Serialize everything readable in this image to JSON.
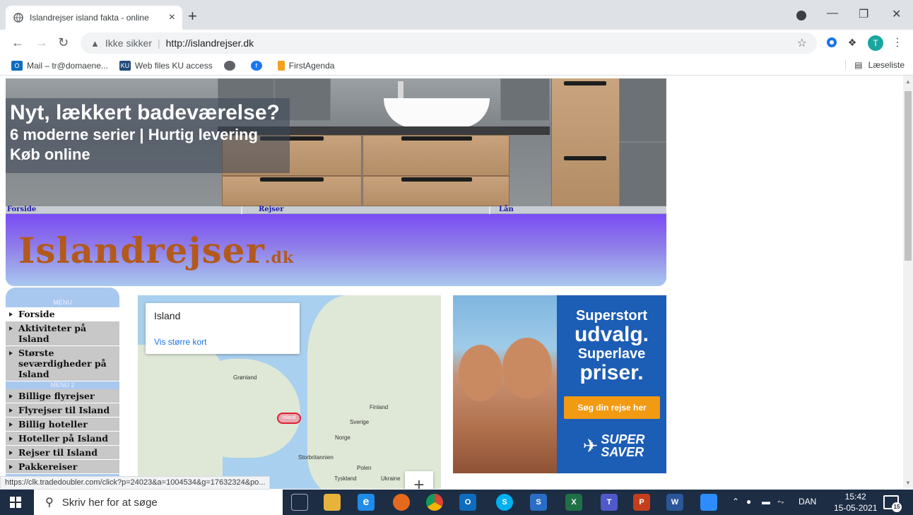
{
  "browser": {
    "tab_title": "Islandrejser island fakta - online",
    "tab_close": "×",
    "new_tab": "+",
    "security_label": "Ikke sikker",
    "address_separator": "|",
    "url": "http://islandrejser.dk",
    "profile_initial": "T",
    "bookmarks": [
      {
        "label": "Mail – tr@domaene...",
        "icon": "outlook-icon",
        "color": "#0f6cbd"
      },
      {
        "label": "Web files KU access",
        "icon": "ku-icon",
        "color": "#234b7a"
      },
      {
        "label": "",
        "icon": "globe-icon",
        "color": "#5f6368"
      },
      {
        "label": "",
        "icon": "facebook-icon",
        "color": "#1877f2"
      },
      {
        "label": "FirstAgenda",
        "icon": "firstagenda-icon",
        "color": "#f4a21e"
      }
    ],
    "reading_list": "Læseliste",
    "status_url": "https://clk.tradedoubler.com/click?p=24023&a=1004534&g=17632324&po..."
  },
  "page": {
    "ad_banner": {
      "headline": "Nyt, lækkert badeværelse?",
      "line2": "6 moderne serier | Hurtig levering",
      "line3": "Køb online"
    },
    "topnav": [
      "Forside",
      "Rejser",
      "Lån"
    ],
    "logo": {
      "name": "Islandrejser",
      "tld": ".dk"
    },
    "menu": {
      "caption1": "MENU",
      "items1": [
        "Forside",
        "Aktiviteter på Island",
        "Største seværdigheder på Island"
      ],
      "caption2": "MENU 2",
      "items2": [
        "Billige flyrejser",
        "Flyrejser til Island",
        "Billig hoteller",
        "Hoteller på Island",
        "Rejser til Island",
        "Pakkereiser"
      ]
    },
    "map": {
      "title": "Island",
      "link": "Vis større kort",
      "labels": {
        "greenland": "Grønland",
        "iceland": "Island",
        "finland": "Finland",
        "sweden": "Sverige",
        "norway": "Norge",
        "uk": "Storbritannien",
        "poland": "Polen",
        "germany": "Tyskland",
        "ukraine": "Ukraine"
      },
      "zoom_in": "+"
    },
    "ad_right": {
      "line1": "Superstort",
      "line2": "udvalg.",
      "line3": "Superlave",
      "line4": "priser.",
      "button": "Søg din rejse her",
      "logo_top": "SUPER",
      "logo_bottom": "SAVER"
    }
  },
  "taskbar": {
    "search_placeholder": "Skriv her for at søge",
    "language": "DAN",
    "time": "15:42",
    "date": "15-05-2021",
    "notifications": "15",
    "apps": [
      {
        "name": "task-view-icon",
        "label": "",
        "color": "transparent"
      },
      {
        "name": "file-explorer-icon",
        "label": "",
        "color": "#e8b33c"
      },
      {
        "name": "edge-icon",
        "label": "e",
        "color": "#1e8ce8"
      },
      {
        "name": "firefox-icon",
        "label": "",
        "color": "#e66a1e"
      },
      {
        "name": "chrome-icon",
        "label": "",
        "color": "#e0a82e"
      },
      {
        "name": "outlook-icon",
        "label": "O",
        "color": "#0f6cbd"
      },
      {
        "name": "skype-icon",
        "label": "S",
        "color": "#00aff0"
      },
      {
        "name": "skype-business-icon",
        "label": "S",
        "color": "#2a6dc5"
      },
      {
        "name": "excel-icon",
        "label": "X",
        "color": "#1e7145"
      },
      {
        "name": "teams-icon",
        "label": "T",
        "color": "#5059c9"
      },
      {
        "name": "powerpoint-icon",
        "label": "P",
        "color": "#c43e1c"
      },
      {
        "name": "word-icon",
        "label": "W",
        "color": "#2b579a"
      },
      {
        "name": "zoom-icon",
        "label": "",
        "color": "#2d8cff"
      }
    ]
  }
}
